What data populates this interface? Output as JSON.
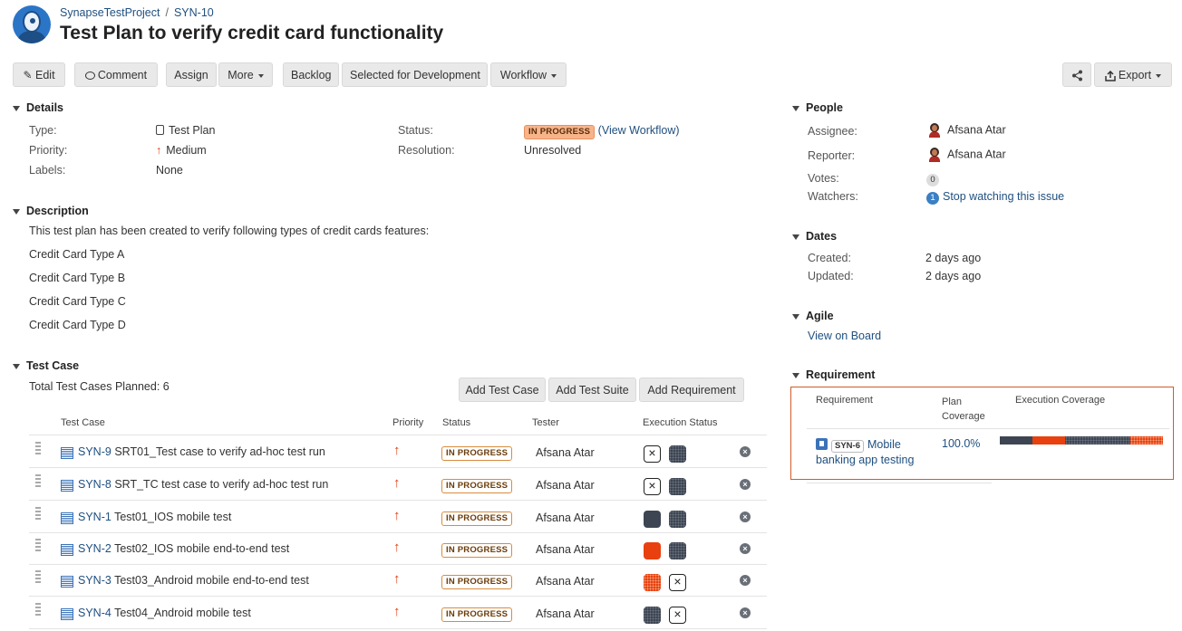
{
  "breadcrumb": {
    "project": "SynapseTestProject",
    "sep": "/",
    "issue_key": "SYN-10"
  },
  "title": "Test Plan to verify credit card functionality",
  "toolbar": {
    "edit": "Edit",
    "comment": "Comment",
    "assign": "Assign",
    "more": "More",
    "backlog": "Backlog",
    "selected": "Selected for Development",
    "workflow": "Workflow",
    "export": "Export"
  },
  "details": {
    "heading": "Details",
    "type_label": "Type:",
    "type_value": "Test Plan",
    "priority_label": "Priority:",
    "priority_value": "Medium",
    "labels_label": "Labels:",
    "labels_value": "None",
    "status_label": "Status:",
    "status_value": "IN PROGRESS",
    "view_workflow": "(View Workflow)",
    "resolution_label": "Resolution:",
    "resolution_value": "Unresolved"
  },
  "description": {
    "heading": "Description",
    "intro": "This test plan has been created to verify following types of credit cards features:",
    "items": [
      "Credit Card Type A",
      "Credit Card Type B",
      "Credit Card Type C",
      "Credit Card Type D"
    ]
  },
  "test_case": {
    "heading": "Test Case",
    "total": "Total Test Cases Planned: 6",
    "buttons": {
      "add_case": "Add Test Case",
      "add_suite": "Add Test Suite",
      "add_req": "Add Requirement"
    },
    "columns": {
      "case": "Test Case",
      "priority": "Priority",
      "status": "Status",
      "tester": "Tester",
      "exec": "Execution Status"
    },
    "rows": [
      {
        "key": "SYN-9",
        "summary": "SRT01_Test case to verify ad-hoc test run",
        "status": "IN PROGRESS",
        "tester": "Afsana Atar",
        "exec": [
          "x",
          "dots"
        ]
      },
      {
        "key": "SYN-8",
        "summary": "SRT_TC test case to verify ad-hoc test run",
        "status": "IN PROGRESS",
        "tester": "Afsana Atar",
        "exec": [
          "x",
          "dots"
        ]
      },
      {
        "key": "SYN-1",
        "summary": "Test01_IOS mobile test",
        "status": "IN PROGRESS",
        "tester": "Afsana Atar",
        "exec": [
          "dark",
          "dots"
        ]
      },
      {
        "key": "SYN-2",
        "summary": "Test02_IOS mobile end-to-end test",
        "status": "IN PROGRESS",
        "tester": "Afsana Atar",
        "exec": [
          "red",
          "dots"
        ]
      },
      {
        "key": "SYN-3",
        "summary": "Test03_Android mobile end-to-end test",
        "status": "IN PROGRESS",
        "tester": "Afsana Atar",
        "exec": [
          "reddots",
          "x"
        ]
      },
      {
        "key": "SYN-4",
        "summary": "Test04_Android mobile test",
        "status": "IN PROGRESS",
        "tester": "Afsana Atar",
        "exec": [
          "dots",
          "x"
        ]
      }
    ]
  },
  "people": {
    "heading": "People",
    "assignee_label": "Assignee:",
    "assignee": "Afsana Atar",
    "reporter_label": "Reporter:",
    "reporter": "Afsana Atar",
    "votes_label": "Votes:",
    "votes": "0",
    "watchers_label": "Watchers:",
    "watchers": "1",
    "stop_watching": "Stop watching this issue"
  },
  "dates": {
    "heading": "Dates",
    "created_label": "Created:",
    "created": "2 days ago",
    "updated_label": "Updated:",
    "updated": "2 days ago"
  },
  "agile": {
    "heading": "Agile",
    "link": "View on Board"
  },
  "requirement": {
    "heading": "Requirement",
    "col_req": "Requirement",
    "col_plan1": "Plan",
    "col_plan2": "Coverage",
    "col_exec": "Execution Coverage",
    "key": "SYN-6",
    "name_line1": "Mobile",
    "name_line2": "banking app testing",
    "coverage": "100.0%",
    "exec_segments": [
      {
        "status": "dark",
        "fraction": 0.2,
        "color": "#3d4552"
      },
      {
        "status": "red",
        "fraction": 0.2,
        "color": "#e8410f"
      },
      {
        "status": "dots",
        "fraction": 0.4,
        "color": "#3d4552"
      },
      {
        "status": "reddots",
        "fraction": 0.2,
        "color": "#e8410f"
      }
    ]
  },
  "colors": {
    "link": "#205081",
    "accent_red": "#e8410f",
    "dark": "#3d4552",
    "status_border": "#d98c3d"
  }
}
